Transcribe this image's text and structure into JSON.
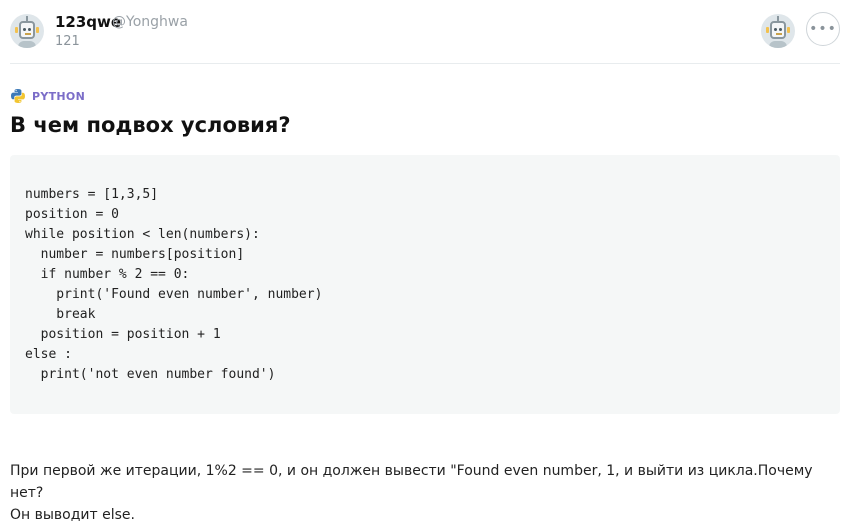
{
  "author": {
    "name": "123qwe",
    "handle": "@Yonghwa",
    "rating": "121"
  },
  "header": {
    "more_icon": "more-dots-icon"
  },
  "tag": {
    "icon": "python-icon",
    "label": "PYTHON"
  },
  "question": {
    "title": "В чем подвох условия?",
    "code_lines": [
      "numbers = [1,3,5]",
      "position = 0",
      "while position < len(numbers):",
      "  number = numbers[position]",
      "  if number % 2 == 0:",
      "    print('Found even number', number)",
      "    break",
      "  position = position + 1",
      "else :",
      "  print('not even number found')"
    ],
    "body_lines": [
      "При первой же итерации, 1%2 == 0, и он должен вывести \"Found even number, 1, и выйти из цикла.Почему нет?",
      "Он выводит else."
    ]
  },
  "colors": {
    "tag_accent": "#7b6dc8",
    "code_background": "#f5f7f7"
  }
}
